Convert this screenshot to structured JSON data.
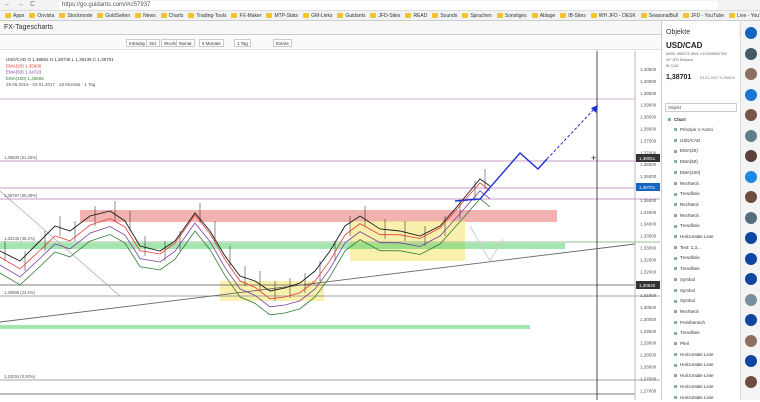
{
  "browser": {
    "url": "https://go.guidants.com/#c/57937",
    "nav": [
      "←",
      "→",
      "C"
    ]
  },
  "bookmarks": [
    "Apps",
    "Onvista",
    "Stockmode",
    "GoldSeiten",
    "News",
    "Charts",
    "Trading-Tools",
    "FX-Maker",
    "MTP-Stats",
    "GM-Links",
    "Guidants",
    "JFD-Sites",
    "READ",
    "Sounds",
    "Sprachen",
    "Sonstiges",
    "Ablage",
    "IB-Sites",
    "WH JFD - DESK",
    "SeasonalBull",
    "JFD - YouTube",
    "Live - YouTube"
  ],
  "app": {
    "title": "FX-Tagescharts",
    "close": "✕"
  },
  "toolbar": [
    "Intraday",
    "Std.",
    "Woche",
    "Monat",
    "6 Monate",
    "1 Tag",
    "Extras"
  ],
  "legend": {
    "symbol": "USD/CAD",
    "ohlc": "O 1,38562  H 1,38745  L 1,38435  C 1,38701",
    "ema20": "EMA(20) 1,35606",
    "ema50": "EMA(50) 1,34723",
    "ema100": "EMA(100) 1,33655",
    "range": "29.06.2016 - 03.01.2017 · 18 Monate · 1 Tag"
  },
  "hlabels": [
    {
      "t": "1,35930 (61,25%)"
    },
    {
      "t": "1,35797 (60,28%)"
    },
    {
      "t": "1,33140 (38,2%)"
    },
    {
      "t": "1,30695 (23,6%)"
    },
    {
      "t": "1,24034 (0,00%)"
    }
  ],
  "yaxis": [
    "1,40500",
    "1,40000",
    "1,39500",
    "1,39000",
    "1,38500",
    "1,38000",
    "1,37500",
    "1,37000",
    "1,36500",
    "1,36000",
    "1,35500",
    "1,35000",
    "1,34500",
    "1,34000",
    "1,33500",
    "1,33000",
    "1,32500",
    "1,32000",
    "1,31500",
    "1,31000",
    "1,30500",
    "1,30000",
    "1,29500",
    "1,29000",
    "1,28500",
    "1,28000",
    "1,27500",
    "1,27000"
  ],
  "price_tags": {
    "last": "1,38701",
    "mark1": "1,38051",
    "mark2": "1,30640"
  },
  "panel": {
    "title": "Objekte",
    "symbol": "USD/CAD",
    "meta1": "WKN: 965275  ISIN: XC0009652759",
    "meta2": "VP   JFD Brokers",
    "meta3": "BI   CAD",
    "price": "1,38701",
    "date": "03.01.2017  0,2961%",
    "search": "Objekt",
    "group": "Chart",
    "items": [
      "Prinzipe V Anzei",
      "USD/CAD",
      "EMA(20)",
      "EMA(50)",
      "EMA(100)",
      "Rechteck",
      "Trendlinie",
      "Rechteck",
      "Rechteck",
      "Trendlinie",
      "Horizontale Linie",
      "Text: 1,3...",
      "Trendlinie",
      "Trendlinie",
      "Symbol",
      "Symbol",
      "Symbol",
      "Rechteck",
      "Preisbereich",
      "Trendlinie",
      "Pfeil",
      "Horizontale Linie",
      "Horizontale Linie",
      "Horizontale Linie",
      "Horizontale Linie",
      "Horizontale Linie"
    ]
  },
  "colors": {
    "ema20": "#e53935",
    "ema50": "#7b3fa0",
    "ema100": "#2e7d32",
    "price": "#1a1a1a",
    "forecast": "#1f2fd6",
    "resistance": "#e8726e",
    "support": "#f7e98a",
    "fib_green": "#56d06a"
  }
}
